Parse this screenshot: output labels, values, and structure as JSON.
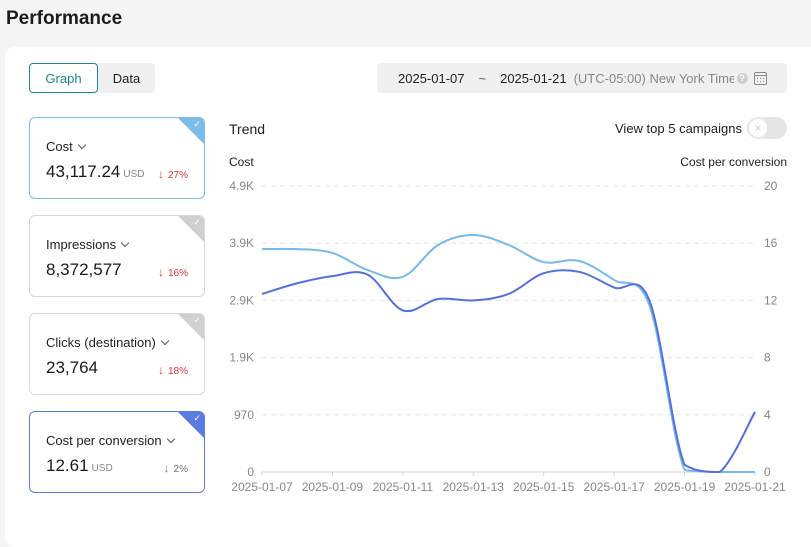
{
  "page": {
    "title": "Performance"
  },
  "view_toggle": {
    "options": [
      {
        "label": "Graph",
        "active": true
      },
      {
        "label": "Data",
        "active": false
      }
    ]
  },
  "date_range": {
    "start": "2025-01-07",
    "separator": "~",
    "end": "2025-01-21",
    "timezone": "(UTC-05:00) New York Time",
    "help_icon": "help-icon",
    "calendar_icon": "calendar-icon"
  },
  "metric_cards": [
    {
      "label": "Cost",
      "value": "43,117.24",
      "unit": "USD",
      "delta": "27%",
      "direction": "down",
      "delta_color": "#d9363e",
      "selected": true,
      "accent": "#7bbde8"
    },
    {
      "label": "Impressions",
      "value": "8,372,577",
      "unit": "",
      "delta": "16%",
      "direction": "down",
      "delta_color": "#d9363e",
      "selected": false,
      "accent": "#d0d0d0"
    },
    {
      "label": "Clicks (destination)",
      "value": "23,764",
      "unit": "",
      "delta": "18%",
      "direction": "down",
      "delta_color": "#d9363e",
      "selected": false,
      "accent": "#d0d0d0"
    },
    {
      "label": "Cost per conversion",
      "value": "12.61",
      "unit": "USD",
      "delta": "2%",
      "direction": "down",
      "delta_color": "#777777",
      "selected": true,
      "accent": "#5b7be0"
    }
  ],
  "trend": {
    "title": "Trend",
    "top5_label": "View top 5 campaigns",
    "top5_enabled": false
  },
  "chart_data": {
    "type": "line",
    "title": "Trend",
    "x": [
      "2025-01-07",
      "2025-01-08",
      "2025-01-09",
      "2025-01-10",
      "2025-01-11",
      "2025-01-12",
      "2025-01-13",
      "2025-01-14",
      "2025-01-15",
      "2025-01-16",
      "2025-01-17",
      "2025-01-18",
      "2025-01-19",
      "2025-01-20",
      "2025-01-21"
    ],
    "x_tick_labels": [
      "2025-01-07",
      "2025-01-09",
      "2025-01-11",
      "2025-01-13",
      "2025-01-15",
      "2025-01-17",
      "2025-01-19",
      "2025-01-21"
    ],
    "y_left": {
      "label": "Cost",
      "ticks": [
        "0",
        "970",
        "1.9K",
        "2.9K",
        "3.9K",
        "4.9K"
      ],
      "range": [
        0,
        4850
      ]
    },
    "y_right": {
      "label": "Cost per conversion",
      "ticks": [
        "0",
        "4",
        "8",
        "12",
        "16",
        "20"
      ],
      "range": [
        0,
        20
      ]
    },
    "grid": true,
    "series": [
      {
        "name": "Cost",
        "axis": "left",
        "color": "#74bbea",
        "values": [
          3780,
          3780,
          3715,
          3425,
          3310,
          3850,
          4020,
          3850,
          3560,
          3580,
          3255,
          2830,
          35,
          0,
          0
        ]
      },
      {
        "name": "Cost per conversion",
        "axis": "right",
        "color": "#5470dc",
        "values": [
          12.45,
          13.2,
          13.7,
          13.8,
          11.3,
          12.1,
          12.0,
          12.45,
          13.9,
          14.0,
          12.9,
          12.0,
          0.5,
          0,
          4.2
        ]
      }
    ]
  }
}
